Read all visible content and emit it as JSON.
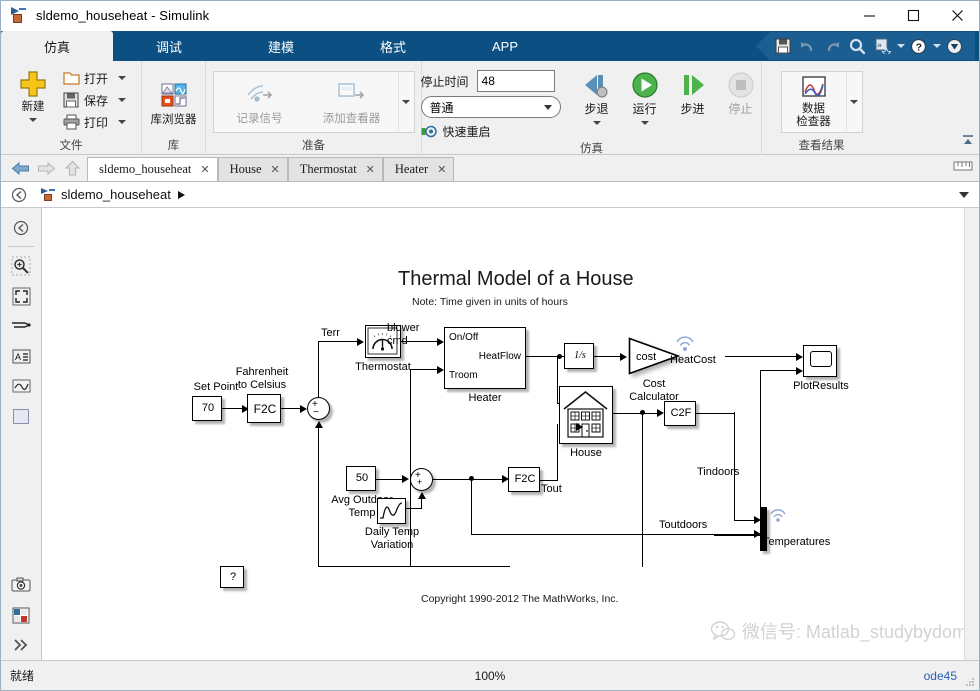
{
  "window": {
    "title": "sldemo_househeat - Simulink",
    "icon": "simulink-model-icon",
    "controls": {
      "minimize": "minimize-icon",
      "maximize": "maximize-icon",
      "close": "close-icon"
    }
  },
  "ribbon": {
    "tabs": [
      {
        "label": "仿真",
        "active": true
      },
      {
        "label": "调试",
        "active": false
      },
      {
        "label": "建模",
        "active": false
      },
      {
        "label": "格式",
        "active": false
      },
      {
        "label": "APP",
        "active": false
      }
    ],
    "quick_access": [
      {
        "name": "save-icon"
      },
      {
        "name": "undo-icon"
      },
      {
        "name": "redo-icon"
      },
      {
        "name": "search-icon"
      },
      {
        "name": "customize-icon"
      },
      {
        "name": "help-icon"
      },
      {
        "name": "minimize-ribbon-icon"
      }
    ],
    "groups": [
      {
        "name": "文件",
        "new_label": "新建",
        "items": [
          {
            "label": "打开",
            "icon": "folder-open-icon"
          },
          {
            "label": "保存",
            "icon": "save-icon"
          },
          {
            "label": "打印",
            "icon": "print-icon"
          }
        ]
      },
      {
        "name": "库",
        "library_label": "库浏览器"
      },
      {
        "name": "准备",
        "items": [
          {
            "label": "记录信号",
            "icon": "log-signal-icon",
            "disabled": true
          },
          {
            "label": "添加查看器",
            "icon": "add-viewer-icon",
            "disabled": true
          }
        ]
      },
      {
        "name": "仿真",
        "stop_time_label": "停止时间",
        "stop_time_value": "48",
        "mode_value": "普通",
        "fast_restart_label": "快速重启",
        "buttons": [
          {
            "label": "步退",
            "icon": "step-back-icon",
            "disabled": false
          },
          {
            "label": "运行",
            "icon": "run-icon",
            "disabled": false
          },
          {
            "label": "步进",
            "icon": "step-forward-icon",
            "disabled": false
          },
          {
            "label": "停止",
            "icon": "stop-icon",
            "disabled": true
          }
        ]
      },
      {
        "name": "查看结果",
        "inspector_label_line1": "数据",
        "inspector_label_line2": "检查器"
      }
    ]
  },
  "model_tabs": [
    {
      "label": "sldemo_househeat",
      "active": true
    },
    {
      "label": "House",
      "active": false
    },
    {
      "label": "Thermostat",
      "active": false
    },
    {
      "label": "Heater",
      "active": false
    }
  ],
  "breadcrumb": {
    "label": "sldemo_househeat"
  },
  "tool_rail": [
    {
      "name": "navigate-back-icon"
    },
    {
      "name": "zoom-in-icon"
    },
    {
      "name": "fit-to-view-icon"
    },
    {
      "name": "signal-routing-icon"
    },
    {
      "name": "annotation-icon"
    },
    {
      "name": "scope-icon"
    },
    {
      "name": "area-icon"
    },
    {
      "name": "camera-icon"
    },
    {
      "name": "layout-icon"
    },
    {
      "name": "more-icon"
    }
  ],
  "diagram": {
    "title": "Thermal Model of a House",
    "note": "Note: Time given in units of hours",
    "copyright": "Copyright 1990-2012 The MathWorks, Inc.",
    "blocks": [
      {
        "name": "set-point-constant",
        "value": "70",
        "label": "Set Point"
      },
      {
        "name": "fahrenheit-to-celsius",
        "value": "F2C",
        "label_line1": "Fahrenheit",
        "label_line2": "to Celsius"
      },
      {
        "name": "sum-error",
        "signs": "+ −"
      },
      {
        "name": "thermostat-subsystem",
        "label": "Thermostat"
      },
      {
        "name": "heater-subsystem",
        "label": "Heater",
        "port_in1": "On/Off",
        "port_in2": "Troom",
        "port_out": "HeatFlow"
      },
      {
        "name": "integrator",
        "value": "1/s"
      },
      {
        "name": "cost-calculator-gain",
        "value": "cost",
        "label_line1": "Cost",
        "label_line2": "Calculator"
      },
      {
        "name": "plot-results-scope",
        "label": "PlotResults"
      },
      {
        "name": "house-subsystem",
        "label": "House"
      },
      {
        "name": "celsius-to-fahrenheit",
        "value": "C2F"
      },
      {
        "name": "avg-outdoor-temp-constant",
        "value": "50",
        "label_line1": "Avg Outdoor",
        "label_line2": "Temp"
      },
      {
        "name": "daily-temp-variation-sine",
        "label_line1": "Daily Temp",
        "label_line2": "Variation"
      },
      {
        "name": "outdoor-f2c",
        "value": "F2C"
      },
      {
        "name": "temperatures-mux",
        "label": "Temperatures"
      },
      {
        "name": "help-doc-block",
        "value": "?"
      }
    ],
    "signal_labels": [
      {
        "name": "signal-label-terr",
        "text": "Terr"
      },
      {
        "name": "signal-label-blower-cmd-line1",
        "text": "blower"
      },
      {
        "name": "signal-label-blower-cmd-line2",
        "text": "cmd"
      },
      {
        "name": "signal-label-heatcost",
        "text": "HeatCost"
      },
      {
        "name": "signal-label-tout",
        "text": "Tout"
      },
      {
        "name": "signal-label-tindoors",
        "text": "Tindoors"
      },
      {
        "name": "signal-label-toutdoors",
        "text": "Toutdoors"
      }
    ]
  },
  "watermark": {
    "text": "微信号: Matlab_studybydomi"
  },
  "status": {
    "left": "就绪",
    "zoom": "100%",
    "solver": "ode45"
  }
}
